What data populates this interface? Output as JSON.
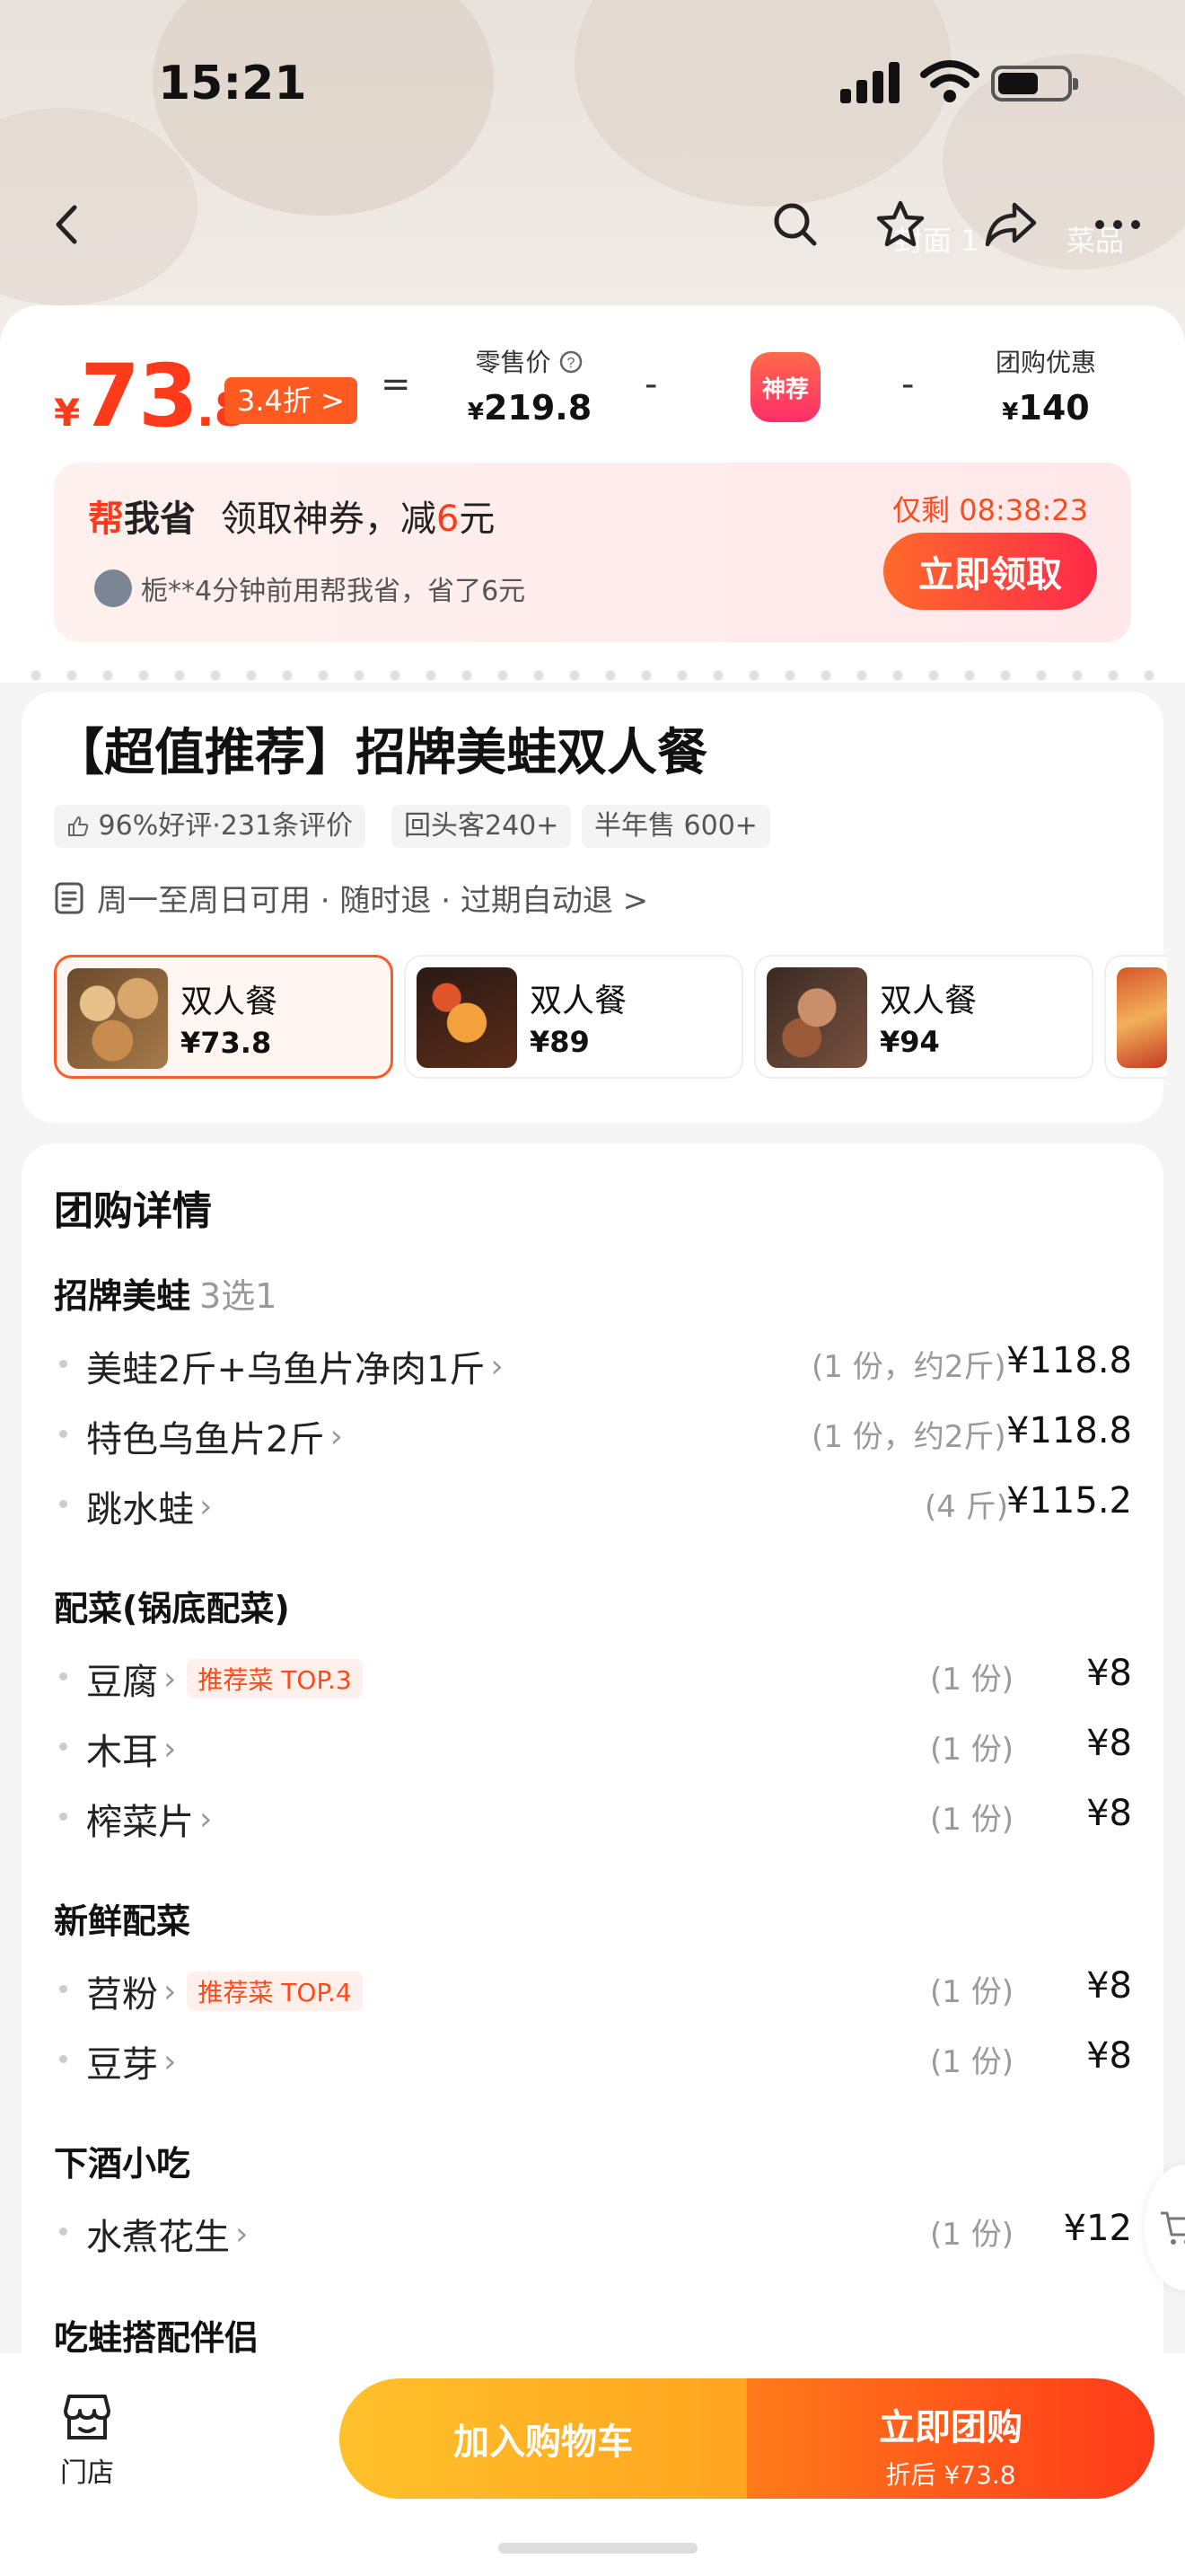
{
  "status": {
    "time": "15:21"
  },
  "nav": {
    "ghost_left": "封面",
    "ghost_left_count": "1",
    "ghost_right": "菜品"
  },
  "price": {
    "currency": "¥",
    "int": "73",
    "dec": ".8",
    "discount": "3.4折 >",
    "eq": "=",
    "minus": "-",
    "retail_label": "零售价",
    "retail_value": "219.8",
    "badge": "神荐",
    "group_label": "团购优惠",
    "group_value": "140"
  },
  "coupon": {
    "brand_red": "帮",
    "brand_black": "我省",
    "text": "领取神券，减",
    "amount": "6",
    "unit": "元",
    "timer": "仅剩 08:38:23",
    "claim": "立即领取",
    "feed": "栀**4分钟前用帮我省，省了6元"
  },
  "product": {
    "title": "【超值推荐】招牌美蛙双人餐",
    "tags": [
      "96%好评·231条评价",
      "回头客240+",
      "半年售 600+"
    ],
    "availability": "周一至周日可用 · 随时退 · 过期自动退 >"
  },
  "packages": [
    {
      "name": "双人餐",
      "price": "¥73.8"
    },
    {
      "name": "双人餐",
      "price": "¥89"
    },
    {
      "name": "双人餐",
      "price": "¥94"
    }
  ],
  "detail": {
    "title": "团购详情",
    "groups": [
      {
        "name": "招牌美蛙",
        "sub": "3选1",
        "items": [
          {
            "name": "美蛙2斤+乌鱼片净肉1斤",
            "qty": "(1 份，约2斤)",
            "price": "¥118.8",
            "rec": ""
          },
          {
            "name": "特色乌鱼片2斤",
            "qty": "(1 份，约2斤)",
            "price": "¥118.8",
            "rec": ""
          },
          {
            "name": "跳水蛙",
            "qty": "(4 斤)",
            "price": "¥115.2",
            "rec": ""
          }
        ]
      },
      {
        "name": "配菜(锅底配菜)",
        "sub": "",
        "items": [
          {
            "name": "豆腐",
            "qty": "(1 份)",
            "price": "¥8",
            "rec": "推荐菜 TOP.3"
          },
          {
            "name": "木耳",
            "qty": "(1 份)",
            "price": "¥8",
            "rec": ""
          },
          {
            "name": "榨菜片",
            "qty": "(1 份)",
            "price": "¥8",
            "rec": ""
          }
        ]
      },
      {
        "name": "新鲜配菜",
        "sub": "",
        "items": [
          {
            "name": "苕粉",
            "qty": "(1 份)",
            "price": "¥8",
            "rec": "推荐菜 TOP.4"
          },
          {
            "name": "豆芽",
            "qty": "(1 份)",
            "price": "¥8",
            "rec": ""
          }
        ]
      },
      {
        "name": "下酒小吃",
        "sub": "",
        "items": [
          {
            "name": "水煮花生",
            "qty": "(1 份)",
            "price": "¥12",
            "rec": ""
          }
        ]
      },
      {
        "name": "吃蛙搭配伴侣",
        "sub": "",
        "items": []
      }
    ]
  },
  "bottom": {
    "store": "门店",
    "add_cart": "加入购物车",
    "buy": "立即团购",
    "buy_sub": "折后 ¥73.8"
  },
  "colors": {
    "accent": "#ff3a1a",
    "cart_btn": "#ffb125",
    "buy_btn": "#ff5a1a"
  }
}
